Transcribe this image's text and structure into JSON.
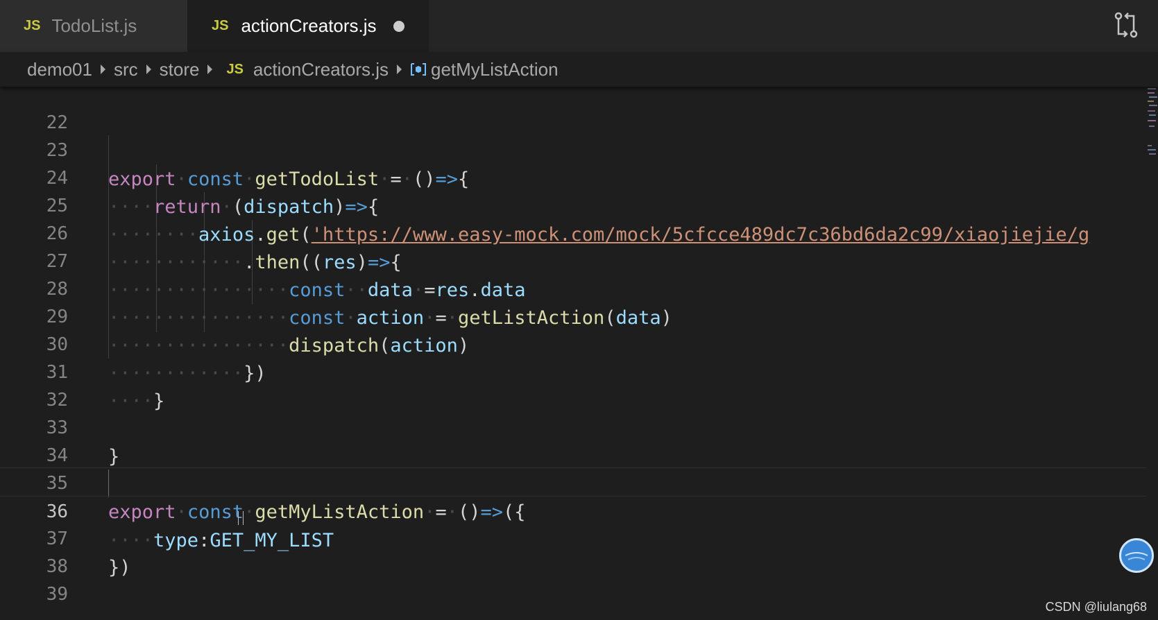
{
  "tabs": [
    {
      "badge": "JS",
      "label": "TodoList.js",
      "active": false
    },
    {
      "badge": "JS",
      "label": "actionCreators.js",
      "active": true,
      "dirty": true
    }
  ],
  "breadcrumb": {
    "segments": [
      "demo01",
      "src",
      "store"
    ],
    "file_badge": "JS",
    "file": "actionCreators.js",
    "symbol": "getMyListAction"
  },
  "editor": {
    "current_line": 36,
    "lines": [
      {
        "n": "22"
      },
      {
        "n": "23"
      },
      {
        "n": "24"
      },
      {
        "n": "25"
      },
      {
        "n": "26"
      },
      {
        "n": "27"
      },
      {
        "n": "28"
      },
      {
        "n": "29"
      },
      {
        "n": "30"
      },
      {
        "n": "31"
      },
      {
        "n": "32"
      },
      {
        "n": "33"
      },
      {
        "n": "34"
      },
      {
        "n": "35"
      },
      {
        "n": "36"
      },
      {
        "n": "37"
      },
      {
        "n": "38"
      },
      {
        "n": "39"
      }
    ],
    "code": {
      "l23": {
        "kw": "export",
        "st": "const",
        "fn": "getTodoList",
        "eq": "=",
        "paren": "()",
        "arrow": "=>",
        "brace": "{"
      },
      "l24": {
        "kw": "return",
        "open": "(",
        "param": "dispatch",
        "close": ")",
        "arrow": "=>",
        "brace": "{"
      },
      "l25": {
        "obj": "axios",
        "dot": ".",
        "fn": "get",
        "open": "(",
        "url": "'https://www.easy-mock.com/mock/5cfcce489dc7c36bd6da2c99/xiaojiejie/g"
      },
      "l26": {
        "dot": ".",
        "fn": "then",
        "open": "((",
        "param": "res",
        "close": ")",
        "arrow": "=>",
        "brace": "{"
      },
      "l27": {
        "st": "const",
        "name": "data",
        "eq": "=",
        "obj": "res",
        "dot": ".",
        "prop": "data"
      },
      "l28": {
        "st": "const",
        "name": "action",
        "eq": "=",
        "fn": "getListAction",
        "open": "(",
        "arg": "data",
        "close": ")"
      },
      "l29": {
        "fn": "dispatch",
        "open": "(",
        "arg": "action",
        "close": ")"
      },
      "l30": {
        "text": "})"
      },
      "l31": {
        "text": "}"
      },
      "l33": {
        "text": "}"
      },
      "l35": {
        "kw": "export",
        "st": "const",
        "fn": "getMyListAction",
        "eq": "=",
        "paren": "()",
        "arrow": "=>",
        "open": "({"
      },
      "l36": {
        "prop": "type",
        "colon": ":",
        "value": "GET_MY_LIST"
      },
      "l37": {
        "text": "})"
      }
    }
  },
  "watermark": "CSDN @liulang68",
  "colors": {
    "keyword": "#c586c0",
    "storage": "#569cd6",
    "function": "#dcdcaa",
    "variable": "#9cdcfe",
    "string": "#ce9178",
    "background": "#1e1e1e"
  },
  "icons": [
    "js-file-icon",
    "unsaved-dot-icon",
    "compare-changes-icon",
    "symbol-variable-icon",
    "chevron-right-icon"
  ]
}
